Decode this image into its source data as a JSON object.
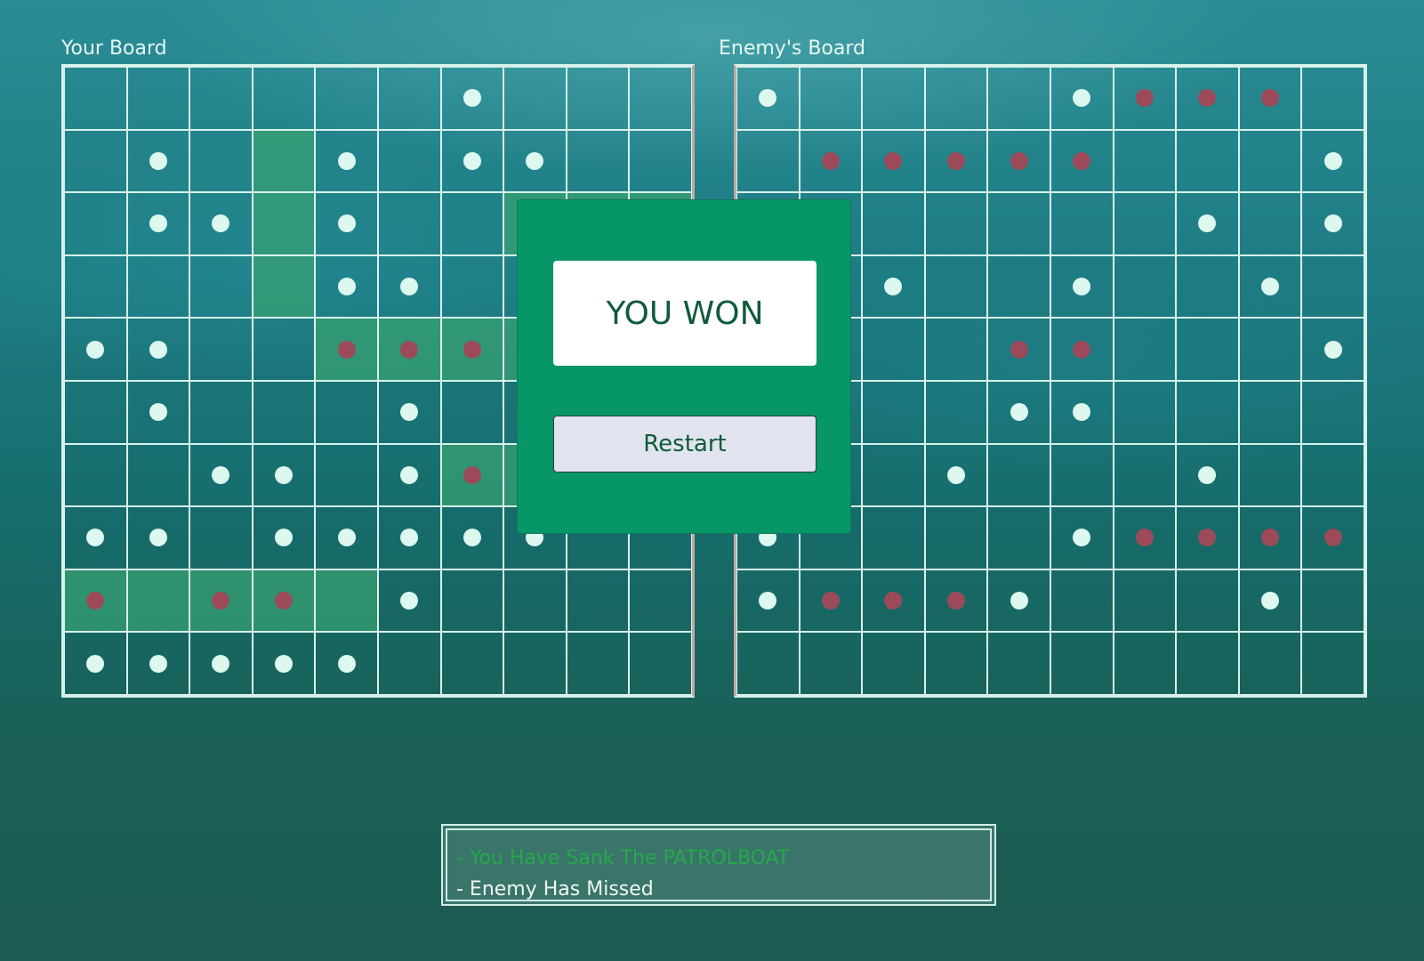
{
  "player_board": {
    "title": "Your Board",
    "ships": [
      [
        1,
        3
      ],
      [
        2,
        3
      ],
      [
        3,
        3
      ],
      [
        2,
        7
      ],
      [
        2,
        8
      ],
      [
        2,
        9
      ],
      [
        4,
        4
      ],
      [
        4,
        5
      ],
      [
        4,
        6
      ],
      [
        4,
        7
      ],
      [
        6,
        6
      ],
      [
        6,
        7
      ],
      [
        8,
        0
      ],
      [
        8,
        1
      ],
      [
        8,
        2
      ],
      [
        8,
        3
      ],
      [
        8,
        4
      ]
    ],
    "misses": [
      [
        0,
        6
      ],
      [
        1,
        1
      ],
      [
        1,
        4
      ],
      [
        1,
        6
      ],
      [
        1,
        7
      ],
      [
        2,
        1
      ],
      [
        2,
        2
      ],
      [
        2,
        4
      ],
      [
        3,
        4
      ],
      [
        3,
        5
      ],
      [
        4,
        0
      ],
      [
        4,
        1
      ],
      [
        5,
        1
      ],
      [
        5,
        5
      ],
      [
        6,
        2
      ],
      [
        6,
        3
      ],
      [
        6,
        5
      ],
      [
        7,
        0
      ],
      [
        7,
        1
      ],
      [
        7,
        3
      ],
      [
        7,
        4
      ],
      [
        7,
        5
      ],
      [
        7,
        6
      ],
      [
        7,
        7
      ],
      [
        8,
        5
      ],
      [
        9,
        0
      ],
      [
        9,
        1
      ],
      [
        9,
        2
      ],
      [
        9,
        3
      ],
      [
        9,
        4
      ]
    ],
    "hits": [
      [
        4,
        4
      ],
      [
        4,
        5
      ],
      [
        4,
        6
      ],
      [
        6,
        6
      ],
      [
        8,
        0
      ],
      [
        8,
        2
      ],
      [
        8,
        3
      ]
    ]
  },
  "enemy_board": {
    "title": "Enemy's Board",
    "misses": [
      [
        0,
        0
      ],
      [
        0,
        5
      ],
      [
        1,
        9
      ],
      [
        2,
        7
      ],
      [
        2,
        9
      ],
      [
        3,
        2
      ],
      [
        3,
        5
      ],
      [
        3,
        8
      ],
      [
        4,
        9
      ],
      [
        5,
        4
      ],
      [
        5,
        5
      ],
      [
        6,
        3
      ],
      [
        6,
        7
      ],
      [
        7,
        0
      ],
      [
        7,
        5
      ],
      [
        8,
        0
      ],
      [
        8,
        4
      ],
      [
        8,
        8
      ]
    ],
    "hits": [
      [
        0,
        6
      ],
      [
        0,
        7
      ],
      [
        0,
        8
      ],
      [
        1,
        1
      ],
      [
        1,
        2
      ],
      [
        1,
        3
      ],
      [
        1,
        4
      ],
      [
        1,
        5
      ],
      [
        4,
        4
      ],
      [
        4,
        5
      ],
      [
        7,
        6
      ],
      [
        7,
        7
      ],
      [
        7,
        8
      ],
      [
        7,
        9
      ],
      [
        8,
        1
      ],
      [
        8,
        2
      ],
      [
        8,
        3
      ]
    ]
  },
  "modal": {
    "result_text": "YOU WON",
    "restart_label": "Restart"
  },
  "log": {
    "lines": [
      {
        "text": "- You Have Sank The PATROLBOAT",
        "type": "success"
      },
      {
        "text": "- Enemy Has Missed",
        "type": "info"
      }
    ]
  },
  "colors": {
    "ship": "#37a073",
    "miss_marker": "#dcf8ef",
    "hit_marker": "#9c4a59",
    "modal_bg": "#069667",
    "result_text": "#0f5a3a",
    "log_success": "#27a84a"
  }
}
